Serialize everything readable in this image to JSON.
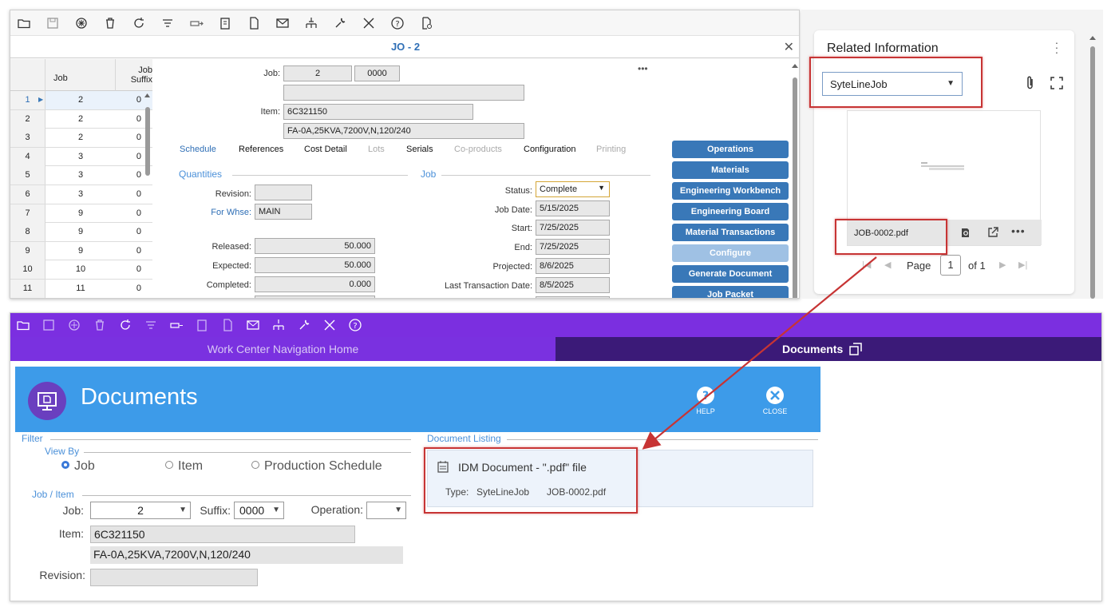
{
  "top_window": {
    "title": "JO - 2",
    "grid": {
      "headers": [
        "Job",
        "Job Suffix"
      ],
      "rows": [
        {
          "n": "1",
          "job": "2",
          "suffix": "0"
        },
        {
          "n": "2",
          "job": "2",
          "suffix": "0"
        },
        {
          "n": "3",
          "job": "2",
          "suffix": "0"
        },
        {
          "n": "4",
          "job": "3",
          "suffix": "0"
        },
        {
          "n": "5",
          "job": "3",
          "suffix": "0"
        },
        {
          "n": "6",
          "job": "3",
          "suffix": "0"
        },
        {
          "n": "7",
          "job": "9",
          "suffix": "0"
        },
        {
          "n": "8",
          "job": "9",
          "suffix": "0"
        },
        {
          "n": "9",
          "job": "9",
          "suffix": "0"
        },
        {
          "n": "10",
          "job": "10",
          "suffix": "0"
        },
        {
          "n": "11",
          "job": "11",
          "suffix": "0"
        }
      ]
    },
    "form": {
      "job_label": "Job:",
      "job_value": "2",
      "suffix_value": "0000",
      "item_label": "Item:",
      "item_value": "6C321150",
      "item_desc": "FA-0A,25KVA,7200V,N,120/240",
      "more": "•••",
      "tabs": [
        "Schedule",
        "References",
        "Cost Detail",
        "Lots",
        "Serials",
        "Co-products",
        "Configuration",
        "Printing"
      ],
      "section_quantities": "Quantities",
      "section_job": "Job",
      "revision_label": "Revision:",
      "whse_label": "For Whse:",
      "whse_value": "MAIN",
      "released_label": "Released:",
      "released_value": "50.000",
      "expected_label": "Expected:",
      "expected_value": "50.000",
      "completed_label": "Completed:",
      "completed_value": "0.000",
      "status_label": "Status:",
      "status_value": "Complete",
      "jobdate_label": "Job Date:",
      "jobdate_value": "5/15/2025",
      "start_label": "Start:",
      "start_value": "7/25/2025",
      "end_label": "End:",
      "end_value": "7/25/2025",
      "projected_label": "Projected:",
      "projected_value": "8/6/2025",
      "lasttx_label": "Last Transaction Date:",
      "lasttx_value": "8/5/2025"
    },
    "actions": [
      "Operations",
      "Materials",
      "Engineering Workbench",
      "Engineering Board",
      "Material Transactions",
      "Configure",
      "Generate Document",
      "Job Packet"
    ]
  },
  "related": {
    "title": "Related Information",
    "select_value": "SyteLineJob",
    "file_name": "JOB-0002.pdf",
    "page_label": "Page",
    "page_value": "1",
    "page_of": "of 1"
  },
  "bottom_window": {
    "tab_home": "Work Center Navigation Home",
    "tab_documents": "Documents",
    "header_title": "Documents",
    "help_label": "HELP",
    "close_label": "CLOSE",
    "filter_label": "Filter",
    "view_by_label": "View By",
    "radio_job": "Job",
    "radio_item": "Item",
    "radio_prod": "Production Schedule",
    "job_item_label": "Job / Item",
    "job_label": "Job:",
    "job_value": "2",
    "suffix_label": "Suffix:",
    "suffix_value": "0000",
    "operation_label": "Operation:",
    "item_label": "Item:",
    "item_value": "6C321150",
    "item_desc": "FA-0A,25KVA,7200V,N,120/240",
    "revision_label": "Revision:",
    "doc_listing_label": "Document Listing",
    "doc_title": "IDM Document - \".pdf\" file",
    "doc_type_label": "Type:",
    "doc_type_value": "SyteLineJob",
    "doc_file": "JOB-0002.pdf"
  },
  "colors": {
    "accent_purple": "#7b2fe0",
    "dark_purple": "#3b1a78",
    "header_blue": "#3d9be9",
    "button_blue": "#3978b8",
    "highlight_red": "#c73434"
  }
}
